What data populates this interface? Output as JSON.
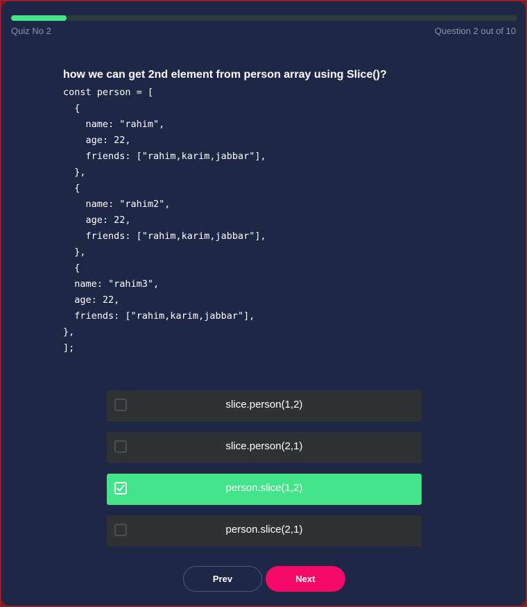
{
  "header": {
    "quiz_label": "Quiz No 2",
    "counter": "Question 2 out of 10",
    "progress_fraction": 0.11
  },
  "question": {
    "text": "how we can get 2nd element from person array using Slice()?",
    "code": "const person = [\n  {\n    name: \"rahim\",\n    age: 22,\n    friends: [\"rahim,karim,jabbar\"],\n  },\n  {\n    name: \"rahim2\",\n    age: 22,\n    friends: [\"rahim,karim,jabbar\"],\n  },\n  {\n  name: \"rahim3\",\n  age: 22,\n  friends: [\"rahim,karim,jabbar\"],\n},\n];"
  },
  "options": [
    {
      "label": "slice.person(1,2)",
      "selected": false
    },
    {
      "label": "slice.person(2,1)",
      "selected": false
    },
    {
      "label": "person.slice(1,2)",
      "selected": true
    },
    {
      "label": "person.slice(2,1)",
      "selected": false
    }
  ],
  "nav": {
    "prev_label": "Prev",
    "next_label": "Next"
  },
  "colors": {
    "background": "#1e2745",
    "accent_green": "#44e48a",
    "next_pink": "#f50a6a",
    "option_bg": "#2f3133"
  }
}
